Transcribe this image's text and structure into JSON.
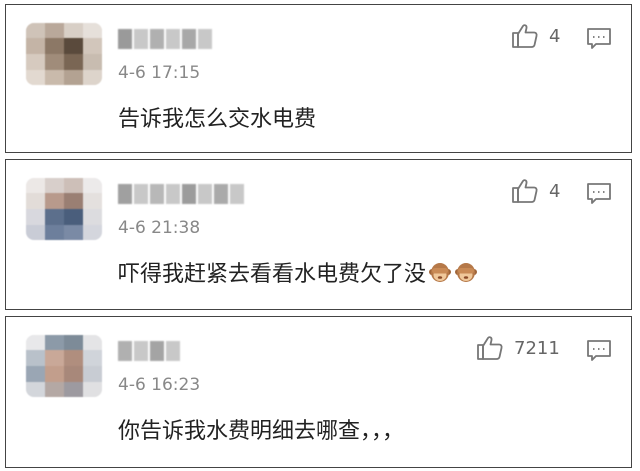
{
  "comments": [
    {
      "timestamp": "4-6 17:15",
      "text": "告诉我怎么交水电费",
      "likes": "4",
      "emoji": []
    },
    {
      "timestamp": "4-6 21:38",
      "text": "吓得我赶紧去看看水电费欠了没",
      "likes": "4",
      "emoji": [
        "see-no-evil-monkey",
        "see-no-evil-monkey"
      ]
    },
    {
      "timestamp": "4-6 16:23",
      "text": "你告诉我水费明细去哪查，，，",
      "likes": "7211",
      "emoji": []
    }
  ],
  "icons": {
    "like": "thumbs-up-icon",
    "reply": "comment-bubble-icon"
  },
  "colors": {
    "border": "#444444",
    "timestamp": "#888888",
    "text": "#222222",
    "icon": "#777777"
  }
}
